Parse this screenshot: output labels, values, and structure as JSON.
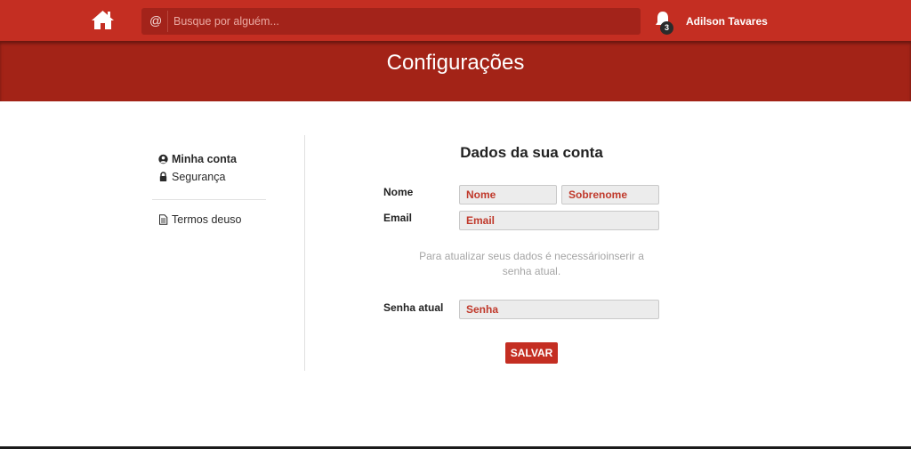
{
  "header": {
    "search_symbol": "@",
    "search_placeholder": "Busque por alguém...",
    "notification_count": "3",
    "user_name": "Adilson Tavares"
  },
  "banner": {
    "title": "Configurações"
  },
  "sidebar": {
    "items": [
      {
        "label": "Minha conta",
        "icon": "user-circle-icon",
        "active": true
      },
      {
        "label": "Segurança",
        "icon": "lock-icon",
        "active": false
      },
      {
        "label": "Termos deuso",
        "icon": "document-icon",
        "active": false
      }
    ]
  },
  "form": {
    "title": "Dados da sua conta",
    "name_label": "Nome",
    "first_name_placeholder": "Nome",
    "last_name_placeholder": "Sobrenome",
    "email_label": "Email",
    "email_placeholder": "Email",
    "hint_line1": "Para atualizar seus dados é necessárioinserir a",
    "hint_line2": "senha atual.",
    "password_label": "Senha atual",
    "password_placeholder": "Senha",
    "save_label": "SALVAR"
  },
  "colors": {
    "topbar": "#c42e22",
    "banner": "#a32317",
    "accent_text": "#c0392b"
  }
}
